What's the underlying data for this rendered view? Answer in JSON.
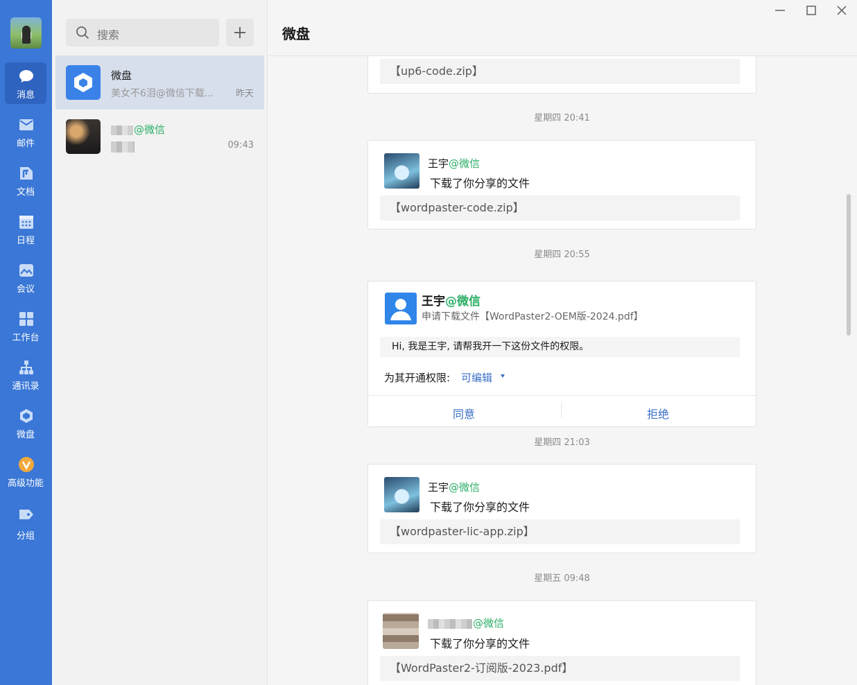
{
  "nav": {
    "items": [
      {
        "label": "消息",
        "icon": "chat-bubble-icon"
      },
      {
        "label": "邮件",
        "icon": "mail-icon"
      },
      {
        "label": "文档",
        "icon": "document-icon"
      },
      {
        "label": "日程",
        "icon": "calendar-icon"
      },
      {
        "label": "会议",
        "icon": "meeting-icon"
      },
      {
        "label": "工作台",
        "icon": "workbench-icon"
      },
      {
        "label": "通讯录",
        "icon": "contacts-icon"
      },
      {
        "label": "微盘",
        "icon": "weipan-icon"
      },
      {
        "label": "高级功能",
        "icon": "premium-icon"
      },
      {
        "label": "分组",
        "icon": "tag-icon"
      }
    ]
  },
  "search": {
    "placeholder": "搜索"
  },
  "sessions": [
    {
      "name": "微盘",
      "preview": "美女不6泪@微信下载...",
      "time": "昨天"
    },
    {
      "name_suffix": "@微信",
      "time": "09:43"
    }
  ],
  "header": {
    "title": "微盘"
  },
  "feed": {
    "card0": {
      "file": "【up6-code.zip】"
    },
    "ts1": "星期四 20:41",
    "card1": {
      "user": "王宇",
      "suffix": "@微信",
      "text": "下载了你分享的文件",
      "file": "【wordpaster-code.zip】"
    },
    "ts2": "星期四 20:55",
    "request": {
      "user": "王宇",
      "suffix": "@微信",
      "subtitle": "申请下载文件【WordPaster2-OEM版-2024.pdf】",
      "message": "Hi, 我是王宇, 请帮我开一下这份文件的权限。",
      "perm_label": "为其开通权限:",
      "perm_value": "可编辑",
      "agree": "同意",
      "reject": "拒绝"
    },
    "ts3": "星期四 21:03",
    "card3": {
      "user": "王宇",
      "suffix": "@微信",
      "text": "下载了你分享的文件",
      "file": "【wordpaster-lic-app.zip】"
    },
    "ts4": "星期五 09:48",
    "card4": {
      "suffix": "@微信",
      "text": "下载了你分享的文件",
      "file": "【WordPaster2-订阅版-2023.pdf】"
    }
  },
  "colors": {
    "rail": "#3a77d6",
    "accent": "#3a6fc4",
    "wechat_green": "#2bae66"
  }
}
